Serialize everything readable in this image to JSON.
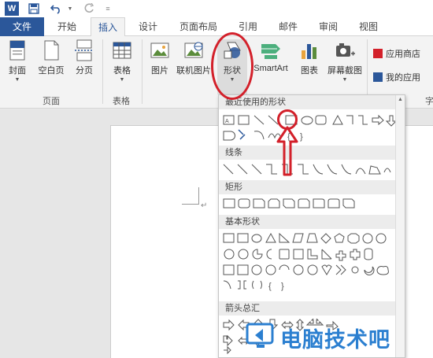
{
  "tabs": [
    {
      "label": "文件"
    },
    {
      "label": "开始"
    },
    {
      "label": "插入"
    },
    {
      "label": "设计"
    },
    {
      "label": "页面布局"
    },
    {
      "label": "引用"
    },
    {
      "label": "邮件"
    },
    {
      "label": "审阅"
    },
    {
      "label": "视图"
    }
  ],
  "ribbon": {
    "pages_group": {
      "cover_label": "封面",
      "blank_label": "空白页",
      "break_label": "分页",
      "group_label": "页面"
    },
    "tables_group": {
      "table_label": "表格",
      "group_label": "表格"
    },
    "illustrations": {
      "picture_label": "图片",
      "online_label": "联机图片",
      "shapes_label": "形状",
      "smartart_label": "SmartArt",
      "chart_label": "图表",
      "screenshot_label": "屏幕截图"
    },
    "apps": {
      "store_label": "应用商店",
      "myapps_label": "我的应用",
      "group_label_partial": "字"
    }
  },
  "gallery": {
    "recent_label": "最近使用的形状",
    "lines_label": "线条",
    "rect_label": "矩形",
    "basic_label": "基本形状",
    "arrows_label": "箭头总汇"
  },
  "doc": {
    "para_mark": "↵"
  },
  "watermark": {
    "text": "电脑技术吧"
  },
  "colors": {
    "accent": "#2b579a",
    "highlight_red": "#d3202a"
  }
}
